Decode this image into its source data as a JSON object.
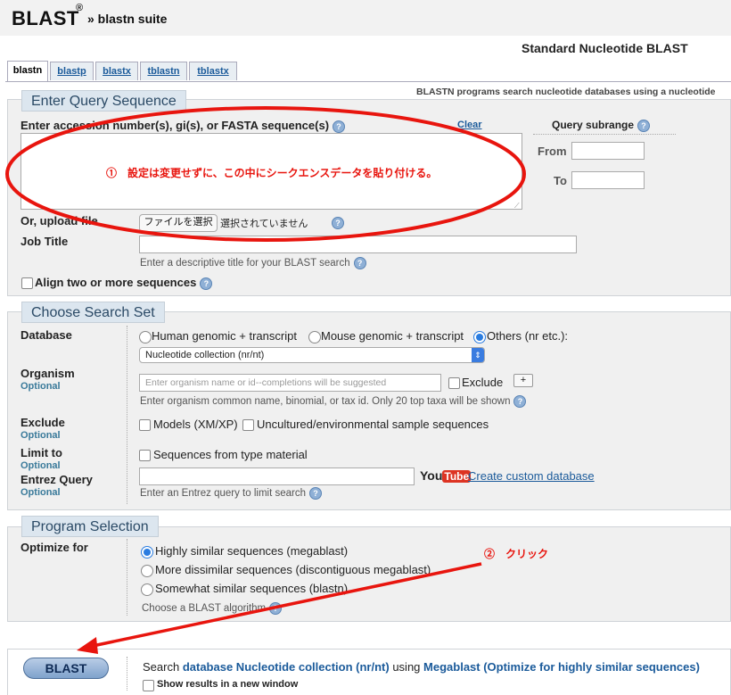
{
  "header": {
    "logo": "BLAST",
    "logo_mark": "®",
    "suite": "» blastn suite",
    "page_title": "Standard Nucleotide BLAST"
  },
  "tabs": [
    {
      "label": "blastn"
    },
    {
      "label": "blastp"
    },
    {
      "label": "blastx"
    },
    {
      "label": "tblastn"
    },
    {
      "label": "tblastx"
    }
  ],
  "description": "BLASTN programs search nucleotide databases using a nucleotide",
  "query": {
    "legend": "Enter Query Sequence",
    "label": "Enter accession number(s), gi(s), or FASTA sequence(s)",
    "clear": "Clear",
    "subrange_label": "Query subrange",
    "from_label": "From",
    "to_label": "To",
    "upload_label": "Or, upload file",
    "file_button": "ファイルを選択",
    "file_status": "選択されていません",
    "job_title_label": "Job Title",
    "job_title_hint": "Enter a descriptive title for your BLAST search",
    "align_label": "Align two or more sequences"
  },
  "search_set": {
    "legend": "Choose Search Set",
    "database_label": "Database",
    "db_options": [
      "Human genomic + transcript",
      "Mouse genomic + transcript",
      "Others (nr etc.):"
    ],
    "db_selected": "Nucleotide collection (nr/nt)",
    "organism_label": "Organism",
    "optional": "Optional",
    "organism_placeholder": "Enter organism name or id--completions will be suggested",
    "exclude_checkbox": "Exclude",
    "plus": "+",
    "organism_hint": "Enter organism common name, binomial, or tax id. Only 20 top taxa will be shown",
    "exclude_label": "Exclude",
    "exclude_models": "Models (XM/XP)",
    "exclude_uncultured": "Uncultured/environmental sample sequences",
    "limit_label": "Limit to",
    "limit_type": "Sequences from type material",
    "entrez_label": "Entrez Query",
    "youtube_you": "You",
    "youtube_tube": "Tube",
    "custom_db_link": "Create custom database",
    "entrez_hint": "Enter an Entrez query to limit search"
  },
  "program": {
    "legend": "Program Selection",
    "optimize_label": "Optimize for",
    "options": [
      "Highly similar sequences (megablast)",
      "More dissimilar sequences (discontiguous megablast)",
      "Somewhat similar sequences (blastn)"
    ],
    "hint": "Choose a BLAST algorithm"
  },
  "submit": {
    "button": "BLAST",
    "search_prefix": "Search",
    "database_text": "database Nucleotide collection (nr/nt)",
    "using": "using",
    "program_text": "Megablast (Optimize for highly similar sequences)",
    "new_window": "Show results in a new window"
  },
  "annotations": {
    "step1": "①　設定は変更せずに、この中にシークエンスデータを貼り付ける。",
    "step2": "②　クリック",
    "color": "#e8150e"
  }
}
